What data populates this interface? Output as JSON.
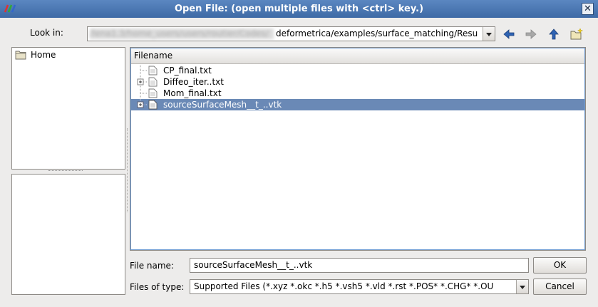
{
  "window": {
    "title": "Open File:  (open multiple files with <ctrl> key.)",
    "close_glyph": "✕"
  },
  "look_in": {
    "label": "Look in:",
    "blurred_path": "/lena1.3/home_users/users/routier/Codes/",
    "path": "deformetrica/examples/surface_matching/Resu"
  },
  "nav_icons": [
    "back-arrow-icon",
    "forward-arrow-icon",
    "up-arrow-icon",
    "new-folder-icon"
  ],
  "sidebar": {
    "items": [
      {
        "label": "Home",
        "icon": "folder-icon"
      }
    ]
  },
  "file_list": {
    "column_header": "Filename",
    "rows": [
      {
        "name": "CP_final.txt",
        "expandable": false,
        "selected": false
      },
      {
        "name": "Diffeo_iter..txt",
        "expandable": true,
        "selected": false
      },
      {
        "name": "Mom_final.txt",
        "expandable": false,
        "selected": false
      },
      {
        "name": "sourceSurfaceMesh__t_..vtk",
        "expandable": true,
        "selected": true
      }
    ]
  },
  "file_name": {
    "label": "File name:",
    "value": "sourceSurfaceMesh__t_..vtk"
  },
  "files_of_type": {
    "label": "Files of type:",
    "value": "Supported Files (*.xyz  *.okc  *.h5 *.vsh5  *.vld *.rst  *.POS* *.CHG*  *.OU"
  },
  "buttons": {
    "ok": "OK",
    "cancel": "Cancel"
  },
  "colors": {
    "titlebar": "#4a78b4",
    "selection": "#6a89b6",
    "nav_arrow": "#2f63b3"
  }
}
